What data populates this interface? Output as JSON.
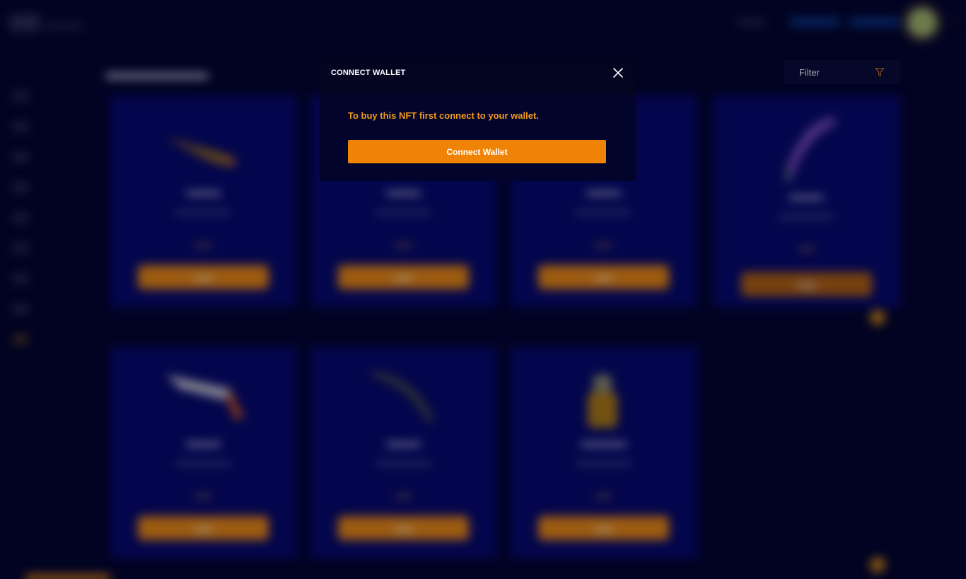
{
  "modal": {
    "title": "CONNECT WALLET",
    "message": "To buy this NFT first connect to your wallet.",
    "connect_button_label": "Connect Wallet",
    "close_icon": "close-icon"
  },
  "toolbar": {
    "filter_label": "Filter",
    "filter_icon": "funnel-icon"
  },
  "colors": {
    "accent": "#ee8306",
    "message": "#f39a1c",
    "background": "#03042a",
    "card": "#06086a"
  }
}
